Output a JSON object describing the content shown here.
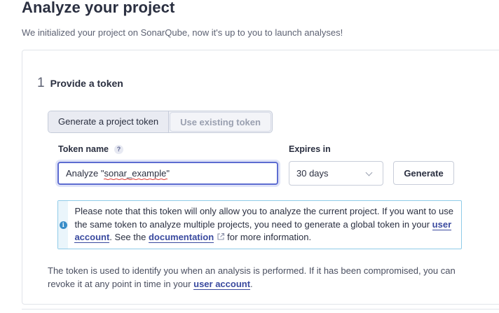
{
  "header": {
    "title": "Analyze your project",
    "subtitle": "We initialized your project on SonarQube, now it's up to you to launch analyses!"
  },
  "step": {
    "number": "1",
    "title": "Provide a token"
  },
  "token_mode": {
    "options": [
      "Generate a project token",
      "Use existing token"
    ],
    "selected": "Generate a project token"
  },
  "form": {
    "token_name_label": "Token name",
    "help_icon": "?",
    "token_name_value": "Analyze \"sonar_example\"",
    "expires_label": "Expires in",
    "expires_value": "30 days",
    "generate_label": "Generate"
  },
  "info": {
    "icon": "i",
    "text_1": "Please note that this token will only allow you to analyze the current project. If you want to use the same token to analyze multiple projects, you need to generate a global token in your",
    "link_user_account": "user account",
    "text_2": ". See the",
    "link_documentation": "documentation",
    "text_3": "for more information."
  },
  "footer": {
    "text_1": "The token is used to identify you when an analysis is performed. If it has been compromised, you can revoke it at any point in time in your",
    "link_user_account": "user account",
    "text_2": "."
  },
  "colors": {
    "accent": "#5d6cd1",
    "link": "#3a4a9f",
    "info_border": "#8fcbe8",
    "info_icon": "#3a8ec8"
  }
}
